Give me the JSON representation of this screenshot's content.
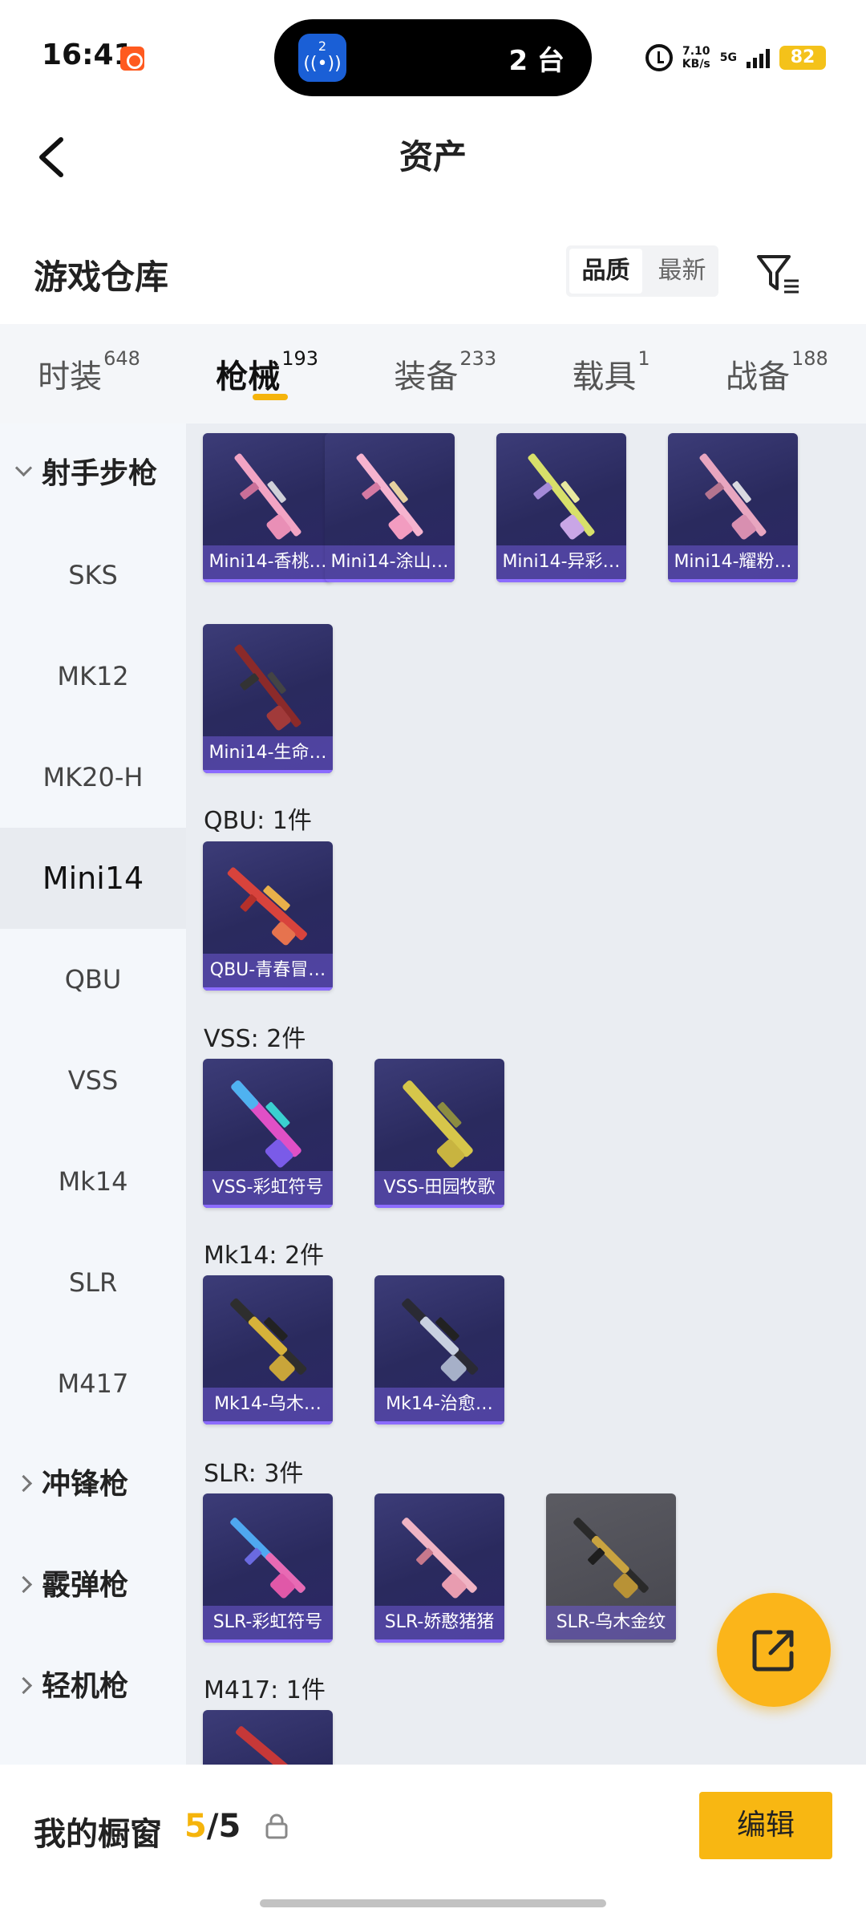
{
  "status_bar": {
    "time": "16:41",
    "island_app_badge": "2",
    "island_count": "2 台",
    "network_speed_value": "7.10",
    "network_speed_unit": "KB/s",
    "network_type": "5G",
    "battery": "82"
  },
  "header": {
    "title": "资产",
    "back_icon": "chevron-left-icon"
  },
  "warehouse": {
    "title": "游戏仓库",
    "sort_options": [
      "品质",
      "最新"
    ],
    "selected_sort": "品质",
    "filter_icon": "filter-icon"
  },
  "tabs": [
    {
      "label": "时装",
      "count": "648",
      "active": false
    },
    {
      "label": "枪械",
      "count": "193",
      "active": true
    },
    {
      "label": "装备",
      "count": "233",
      "active": false
    },
    {
      "label": "载具",
      "count": "1",
      "active": false
    },
    {
      "label": "战备",
      "count": "188",
      "active": false
    }
  ],
  "sidebar": {
    "open_category": "射手步枪",
    "sub_items": [
      "SKS",
      "MK12",
      "MK20-H",
      "Mini14",
      "QBU",
      "VSS",
      "Mk14",
      "SLR",
      "M417"
    ],
    "selected": "Mini14",
    "other_categories": [
      "冲锋枪",
      "霰弹枪",
      "轻机枪"
    ]
  },
  "groups": [
    {
      "label": "",
      "items": [
        "Mini14-香桃…",
        "Mini14-涂山…",
        "Mini14-异彩…",
        "Mini14-耀粉…",
        "Mini14-生命…"
      ]
    },
    {
      "label": "QBU: 1件",
      "items": [
        "QBU-青春冒…"
      ]
    },
    {
      "label": "VSS: 2件",
      "items": [
        "VSS-彩虹符号",
        "VSS-田园牧歌"
      ]
    },
    {
      "label": "Mk14: 2件",
      "items": [
        "Mk14-乌木…",
        "Mk14-治愈…"
      ]
    },
    {
      "label": "SLR: 3件",
      "items": [
        "SLR-彩虹符号",
        "SLR-娇憨猪猪",
        "SLR-乌木金纹"
      ]
    },
    {
      "label": "M417: 1件",
      "items": [
        ""
      ]
    }
  ],
  "colors": {
    "accent": "#f5b40c",
    "card_bg": "#2c2766",
    "card_label": "#8c6cff"
  },
  "bottom_bar": {
    "label": "我的橱窗",
    "count_current": "5",
    "count_separator": "/",
    "count_total": "5",
    "edit_label": "编辑"
  },
  "fab_icon": "share-out-icon"
}
